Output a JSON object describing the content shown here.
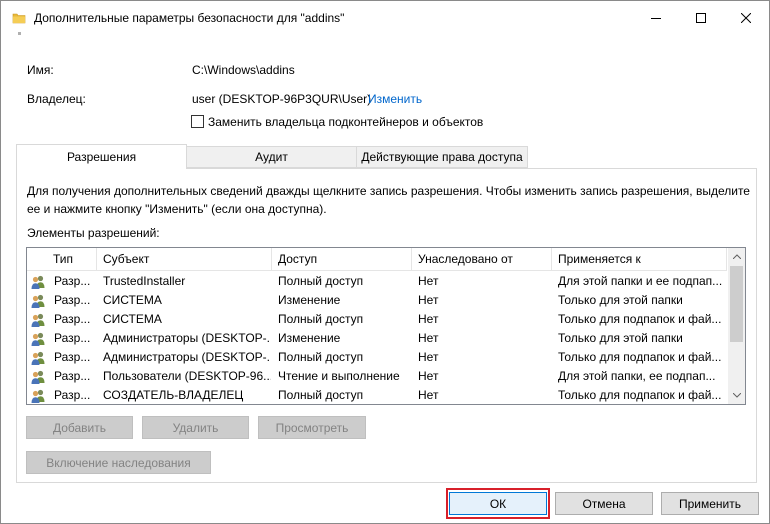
{
  "window": {
    "title": "Дополнительные параметры безопасности  для \"addins\""
  },
  "info": {
    "name_label": "Имя:",
    "name_value": "C:\\Windows\\addins",
    "owner_label": "Владелец:",
    "owner_value": "user (DESKTOP-96P3QUR\\User)",
    "owner_change_link": "Изменить",
    "replace_owner_checkbox": "Заменить владельца подконтейнеров и объектов"
  },
  "tabs": [
    {
      "label": "Разрешения",
      "active": true
    },
    {
      "label": "Аудит",
      "active": false
    },
    {
      "label": "Действующие права доступа",
      "active": false
    }
  ],
  "permissions": {
    "hint_line1": "Для получения дополнительных сведений дважды щелкните запись разрешения. Чтобы изменить запись разрешения, выделите",
    "hint_line2": "ее и нажмите кнопку \"Изменить\" (если она доступна).",
    "list_label": "Элементы разрешений:",
    "columns": [
      "Тип",
      "Субъект",
      "Доступ",
      "Унаследовано от",
      "Применяется к"
    ],
    "rows": [
      {
        "type": "Разр...",
        "subject": "TrustedInstaller",
        "access": "Полный доступ",
        "inherited": "Нет",
        "applies": "Для этой папки и ее подпап..."
      },
      {
        "type": "Разр...",
        "subject": "СИСТЕМА",
        "access": "Изменение",
        "inherited": "Нет",
        "applies": "Только для этой папки"
      },
      {
        "type": "Разр...",
        "subject": "СИСТЕМА",
        "access": "Полный доступ",
        "inherited": "Нет",
        "applies": "Только для подпапок и фай..."
      },
      {
        "type": "Разр...",
        "subject": "Администраторы (DESKTOP-...",
        "access": "Изменение",
        "inherited": "Нет",
        "applies": "Только для этой папки"
      },
      {
        "type": "Разр...",
        "subject": "Администраторы (DESKTOP-...",
        "access": "Полный доступ",
        "inherited": "Нет",
        "applies": "Только для подпапок и фай..."
      },
      {
        "type": "Разр...",
        "subject": "Пользователи (DESKTOP-96...",
        "access": "Чтение и выполнение",
        "inherited": "Нет",
        "applies": "Для этой папки, ее подпап..."
      },
      {
        "type": "Разр...",
        "subject": "СОЗДАТЕЛЬ-ВЛАДЕЛЕЦ",
        "access": "Полный доступ",
        "inherited": "Нет",
        "applies": "Только для подпапок и фай..."
      }
    ],
    "buttons": {
      "add": "Добавить",
      "remove": "Удалить",
      "view": "Просмотреть",
      "enable_inheritance": "Включение наследования"
    }
  },
  "footer": {
    "ok": "ОК",
    "cancel": "Отмена",
    "apply": "Применить"
  },
  "icons": {
    "title": "folder-icon",
    "row": "users-icon"
  },
  "colors": {
    "link": "#0066cc",
    "highlight_border": "#d8202a",
    "ok_border": "#0078d7"
  }
}
